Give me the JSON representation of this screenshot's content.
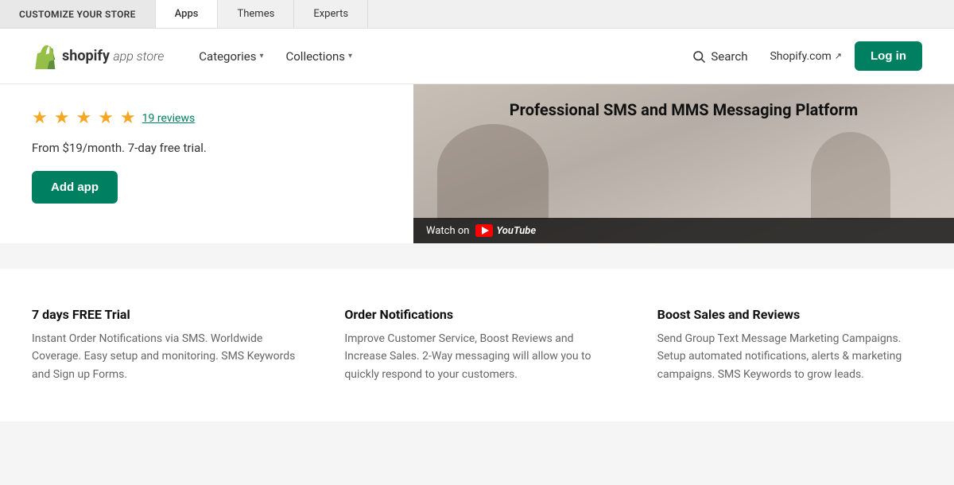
{
  "top_nav": {
    "items": [
      {
        "label": "CUSTOMIZE YOUR STORE",
        "active": false
      },
      {
        "label": "Apps",
        "active": true
      },
      {
        "label": "Themes",
        "active": false
      },
      {
        "label": "Experts",
        "active": false
      }
    ]
  },
  "header": {
    "logo": {
      "name": "shopify",
      "app_store_text": "app store"
    },
    "nav": {
      "categories_label": "Categories",
      "collections_label": "Collections"
    },
    "search_label": "Search",
    "shopify_com_label": "Shopify.com",
    "login_label": "Log in"
  },
  "app_detail": {
    "stars": [
      "★",
      "★",
      "★",
      "★",
      "★"
    ],
    "reviews_count": "19 reviews",
    "price_text": "From $19/month. 7-day free trial.",
    "add_app_label": "Add app",
    "video_title": "Professional SMS and MMS Messaging Platform",
    "watch_on_label": "Watch on",
    "youtube_label": "YouTube"
  },
  "features": [
    {
      "title": "7 days FREE Trial",
      "description": "Instant Order Notifications via SMS. Worldwide Coverage. Easy setup and monitoring. SMS Keywords and Sign up Forms."
    },
    {
      "title": "Order Notifications",
      "description": "Improve Customer Service, Boost Reviews and Increase Sales. 2-Way messaging will allow you to quickly respond to your customers."
    },
    {
      "title": "Boost Sales and Reviews",
      "description": "Send Group Text Message Marketing Campaigns. Setup automated notifications, alerts & marketing campaigns. SMS Keywords to grow leads."
    }
  ]
}
